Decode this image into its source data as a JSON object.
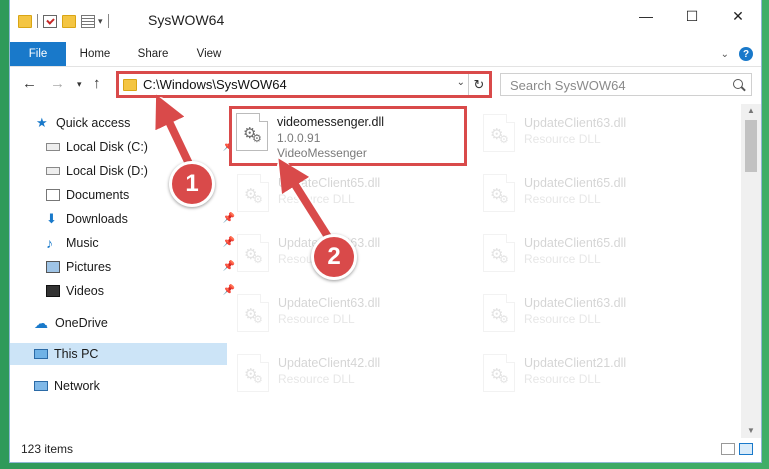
{
  "window": {
    "title": "SysWOW64",
    "controls": {
      "minimize": "—",
      "maximize": "☐",
      "close": "✕"
    }
  },
  "ribbon": {
    "tabs": [
      {
        "label": "File"
      },
      {
        "label": "Home"
      },
      {
        "label": "Share"
      },
      {
        "label": "View"
      }
    ],
    "help": "?"
  },
  "address": {
    "path": "C:\\Windows\\SysWOW64",
    "search_placeholder": "Search SysWOW64"
  },
  "sidebar": {
    "items": [
      {
        "label": "Quick access",
        "icon": "star-icon"
      },
      {
        "label": "Local Disk (C:)",
        "icon": "drive-icon",
        "pinned": true
      },
      {
        "label": "Local Disk (D:)",
        "icon": "drive-icon"
      },
      {
        "label": "Documents",
        "icon": "documents-icon"
      },
      {
        "label": "Downloads",
        "icon": "download-icon",
        "pinned": true
      },
      {
        "label": "Music",
        "icon": "music-icon",
        "pinned": true
      },
      {
        "label": "Pictures",
        "icon": "pictures-icon",
        "pinned": true
      },
      {
        "label": "Videos",
        "icon": "videos-icon",
        "pinned": true
      },
      {
        "label": "OneDrive",
        "icon": "cloud-icon"
      },
      {
        "label": "This PC",
        "icon": "computer-icon",
        "selected": true
      },
      {
        "label": "Network",
        "icon": "network-icon"
      }
    ]
  },
  "files": [
    {
      "name": "videomessenger.dll",
      "line2": "1.0.0.91",
      "line3": "VideoMessenger",
      "highlight": true
    },
    {
      "name": "UpdateClient63.dll",
      "line2": "Resource DLL"
    },
    {
      "name": "UpdateClient65.dll",
      "line2": "Resource DLL"
    },
    {
      "name": "UpdateClient65.dll",
      "line2": "Resource DLL"
    },
    {
      "name": "UpdateClient63.dll",
      "line2": "Resource DLL"
    },
    {
      "name": "UpdateClient65.dll",
      "line2": "Resource DLL"
    },
    {
      "name": "UpdateClient63.dll",
      "line2": "Resource DLL"
    },
    {
      "name": "UpdateClient63.dll",
      "line2": "Resource DLL"
    },
    {
      "name": "UpdateClient42.dll",
      "line2": "Resource DLL"
    },
    {
      "name": "UpdateClient21.dll",
      "line2": "Resource DLL"
    }
  ],
  "status": {
    "item_count": "123 items"
  },
  "annotations": {
    "badge1": "1",
    "badge2": "2",
    "color": "#d94a4a"
  }
}
